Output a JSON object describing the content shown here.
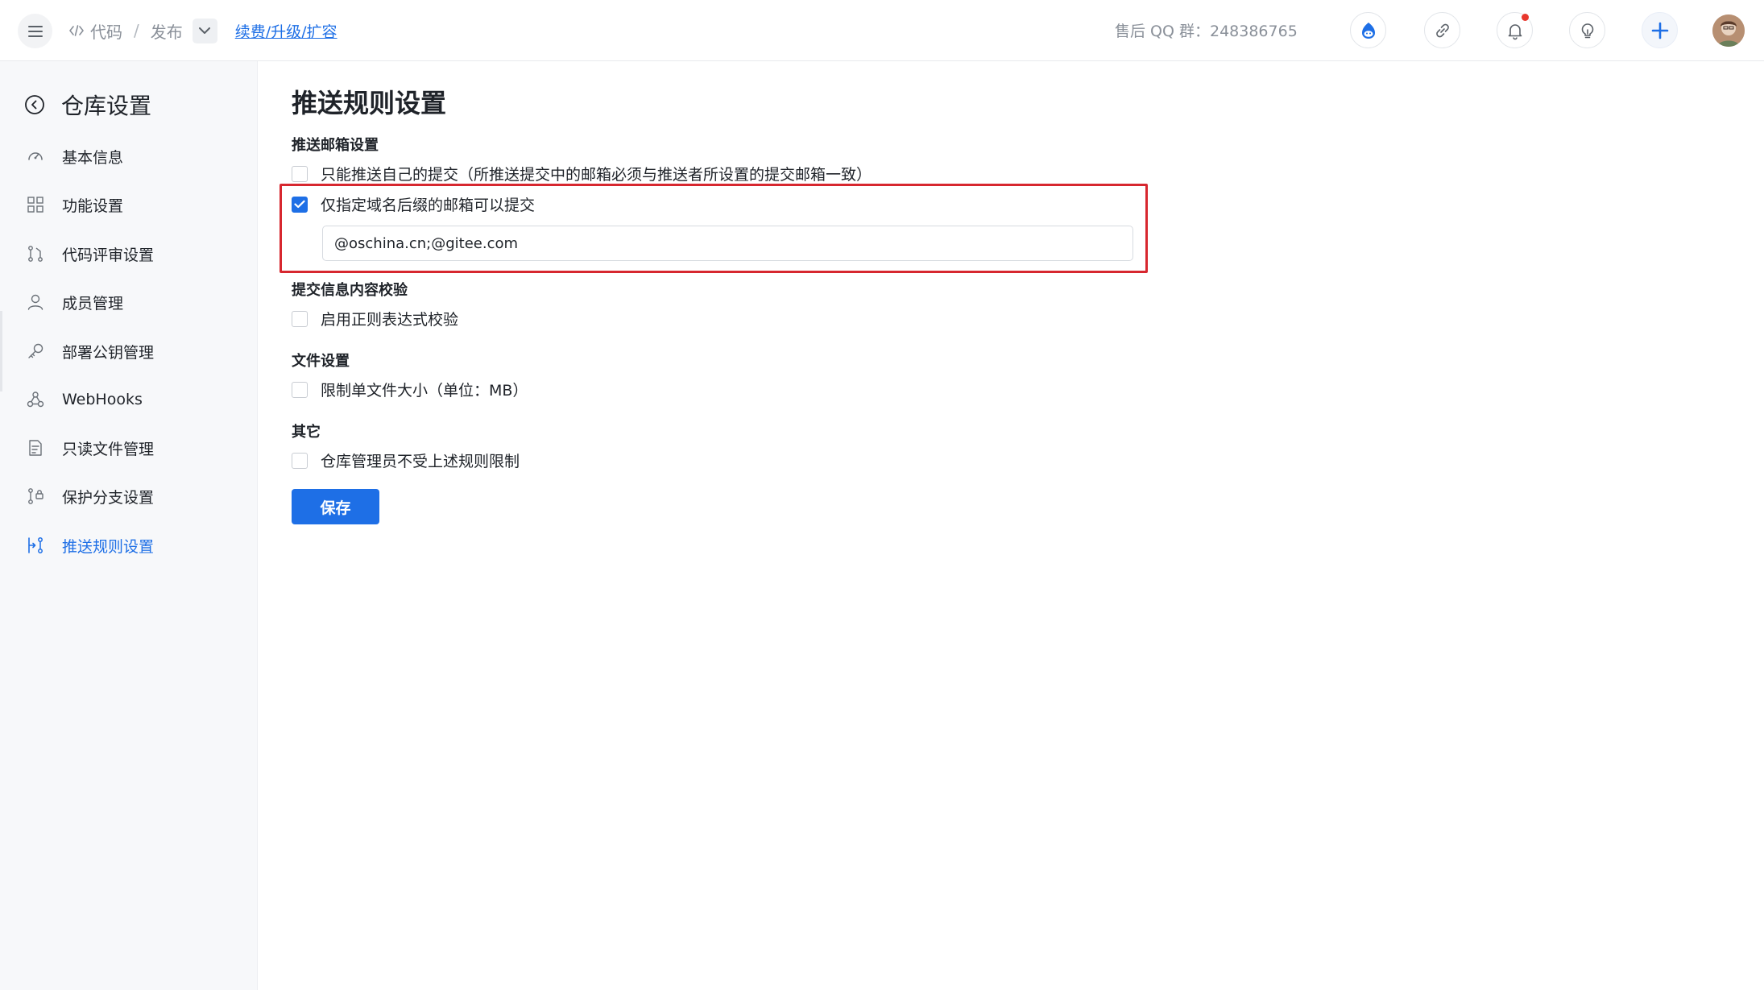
{
  "header": {
    "breadcrumb": {
      "code_label": "代码",
      "separator": "/",
      "release_label": "发布",
      "renew_link": "续费/升级/扩容"
    },
    "support_text": "售后 QQ 群：248386765",
    "icons": [
      "gitee-assistant-icon",
      "link-icon",
      "bell-icon",
      "lightbulb-icon",
      "plus-icon"
    ],
    "notification_badge_color": "#e8372d",
    "accent_color": "#1e6fe6"
  },
  "sidebar": {
    "title": "仓库设置",
    "items": [
      {
        "label": "基本信息",
        "icon": "dashboard-icon"
      },
      {
        "label": "功能设置",
        "icon": "grid-icon"
      },
      {
        "label": "代码评审设置",
        "icon": "review-icon"
      },
      {
        "label": "成员管理",
        "icon": "user-icon"
      },
      {
        "label": "部署公钥管理",
        "icon": "key-icon"
      },
      {
        "label": "WebHooks",
        "icon": "webhook-icon"
      },
      {
        "label": "只读文件管理",
        "icon": "file-icon"
      },
      {
        "label": "保护分支设置",
        "icon": "branch-lock-icon"
      },
      {
        "label": "推送规则设置",
        "icon": "push-rule-icon",
        "active": true
      }
    ]
  },
  "main": {
    "title": "推送规则设置",
    "email_section": {
      "label": "推送邮箱设置",
      "own_commits_only": {
        "label": "只能推送自己的提交（所推送提交中的邮箱必须与推送者所设置的提交邮箱一致）",
        "checked": false
      },
      "domain_only": {
        "label": "仅指定域名后缀的邮箱可以提交",
        "checked": true,
        "value": "@oschina.cn;@gitee.com"
      }
    },
    "message_section": {
      "label": "提交信息内容校验",
      "regex": {
        "label": "启用正则表达式校验",
        "checked": false
      }
    },
    "file_section": {
      "label": "文件设置",
      "size_limit": {
        "label": "限制单文件大小（单位：MB）",
        "checked": false
      }
    },
    "other_section": {
      "label": "其它",
      "admin_exempt": {
        "label": "仓库管理员不受上述规则限制",
        "checked": false
      }
    },
    "save_button": "保存",
    "highlight_color": "#d7272f"
  }
}
